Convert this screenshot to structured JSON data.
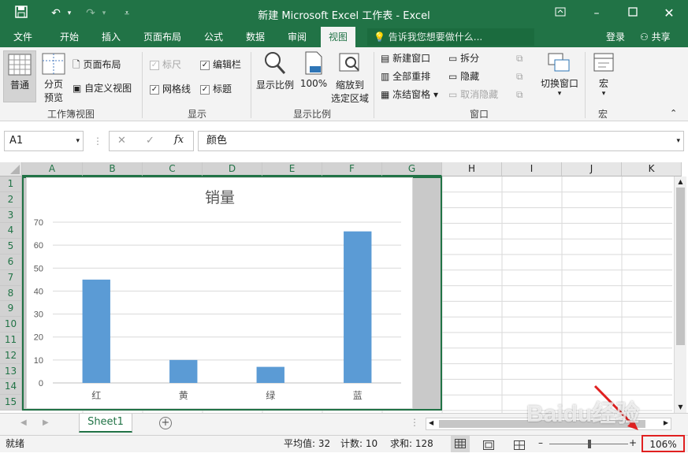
{
  "window": {
    "title": "新建 Microsoft Excel 工作表 - Excel"
  },
  "tabs": [
    "文件",
    "开始",
    "插入",
    "页面布局",
    "公式",
    "数据",
    "审阅",
    "视图"
  ],
  "tell_me": "告诉我您想要做什么...",
  "login": "登录",
  "share": "共享",
  "ribbon": {
    "workbook_views": {
      "normal": "普通",
      "page_break_1": "分页",
      "page_break_2": "预览",
      "page_layout": "页面布局",
      "custom_views": "自定义视图",
      "group": "工作簿视图"
    },
    "show": {
      "ruler": "标尺",
      "formula_bar": "编辑栏",
      "gridlines": "网格线",
      "headings": "标题",
      "group": "显示"
    },
    "zoom": {
      "zoom": "显示比例",
      "zoom100": "100%",
      "zoom_sel_1": "缩放到",
      "zoom_sel_2": "选定区域",
      "group": "显示比例"
    },
    "window": {
      "new_window": "新建窗口",
      "arrange_all": "全部重排",
      "freeze": "冻结窗格",
      "split": "拆分",
      "hide": "隐藏",
      "unhide": "取消隐藏",
      "switch": "切换窗口",
      "group": "窗口"
    },
    "macros": {
      "macros": "宏",
      "group": "宏"
    }
  },
  "formula_bar": {
    "name_box": "A1",
    "fx": "fx",
    "value": "颜色"
  },
  "columns": [
    "A",
    "B",
    "C",
    "D",
    "E",
    "F",
    "G",
    "H",
    "I",
    "J",
    "K"
  ],
  "rows": [
    "1",
    "2",
    "3",
    "4",
    "5",
    "6",
    "7",
    "8",
    "9",
    "10",
    "11",
    "12",
    "13",
    "14",
    "15"
  ],
  "sheet_tab": "Sheet1",
  "status": {
    "ready": "就绪",
    "average": "平均值: 32",
    "count": "计数: 10",
    "sum": "求和: 128",
    "zoom": "106%"
  },
  "watermark": "Baidu经验",
  "chart_data": {
    "type": "bar",
    "title": "销量",
    "categories": [
      "红",
      "黄",
      "绿",
      "蓝"
    ],
    "values": [
      45,
      10,
      7,
      66
    ],
    "ylim": [
      0,
      70
    ],
    "yticks": [
      0,
      10,
      20,
      30,
      40,
      50,
      60,
      70
    ],
    "grid": true,
    "color": "#5b9bd5"
  }
}
